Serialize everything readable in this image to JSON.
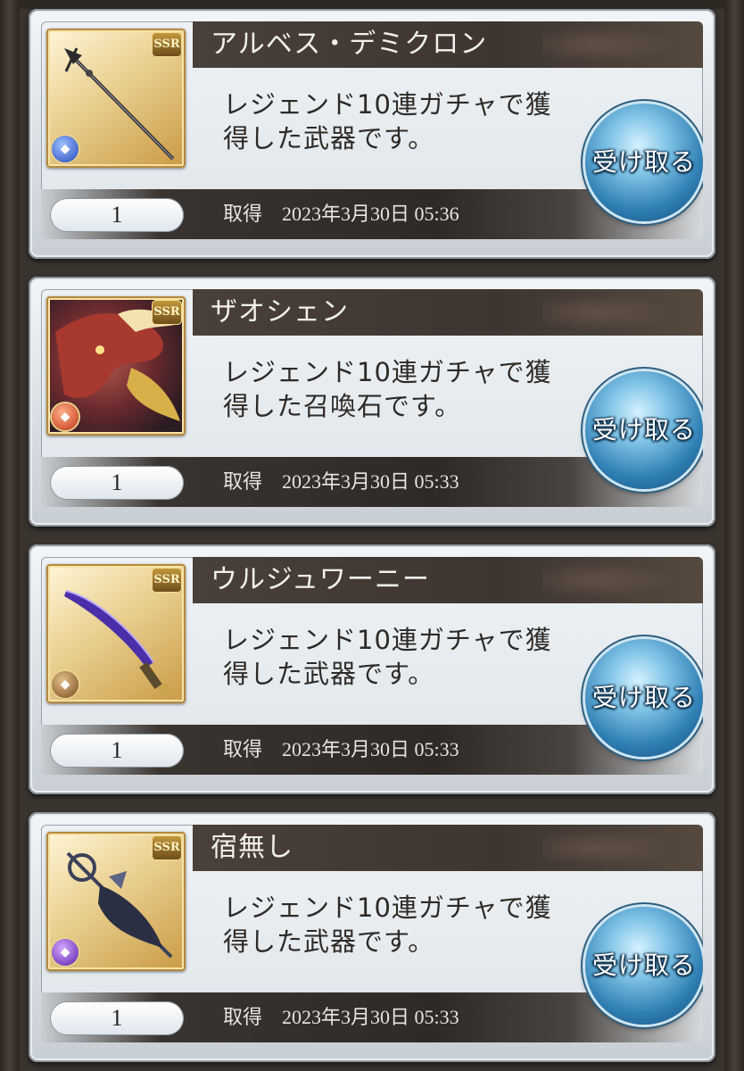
{
  "items": [
    {
      "name": "アルベス・デミクロン",
      "rarity": "SSR",
      "element": "water",
      "element_icon": "water-element-icon",
      "description_line1": "レジェンド10連ガチャで獲",
      "description_line2": "得した武器です。",
      "quantity": "1",
      "obtained_label": "取得",
      "obtained_date": "2023年3月30日 05:36",
      "receive_label": "受け取る"
    },
    {
      "name": "ザオシェン",
      "rarity": "SSR",
      "element": "fire",
      "element_icon": "fire-element-icon",
      "description_line1": "レジェンド10連ガチャで獲",
      "description_line2": "得した召喚石です。",
      "quantity": "1",
      "obtained_label": "取得",
      "obtained_date": "2023年3月30日 05:33",
      "receive_label": "受け取る"
    },
    {
      "name": "ウルジュワーニー",
      "rarity": "SSR",
      "element": "earth",
      "element_icon": "earth-element-icon",
      "description_line1": "レジェンド10連ガチャで獲",
      "description_line2": "得した武器です。",
      "quantity": "1",
      "obtained_label": "取得",
      "obtained_date": "2023年3月30日 05:33",
      "receive_label": "受け取る"
    },
    {
      "name": "宿無し",
      "rarity": "SSR",
      "element": "dark",
      "element_icon": "dark-element-icon",
      "description_line1": "レジェンド10連ガチャで獲",
      "description_line2": "得した武器です。",
      "quantity": "1",
      "obtained_label": "取得",
      "obtained_date": "2023年3月30日 05:33",
      "receive_label": "受け取る"
    }
  ]
}
